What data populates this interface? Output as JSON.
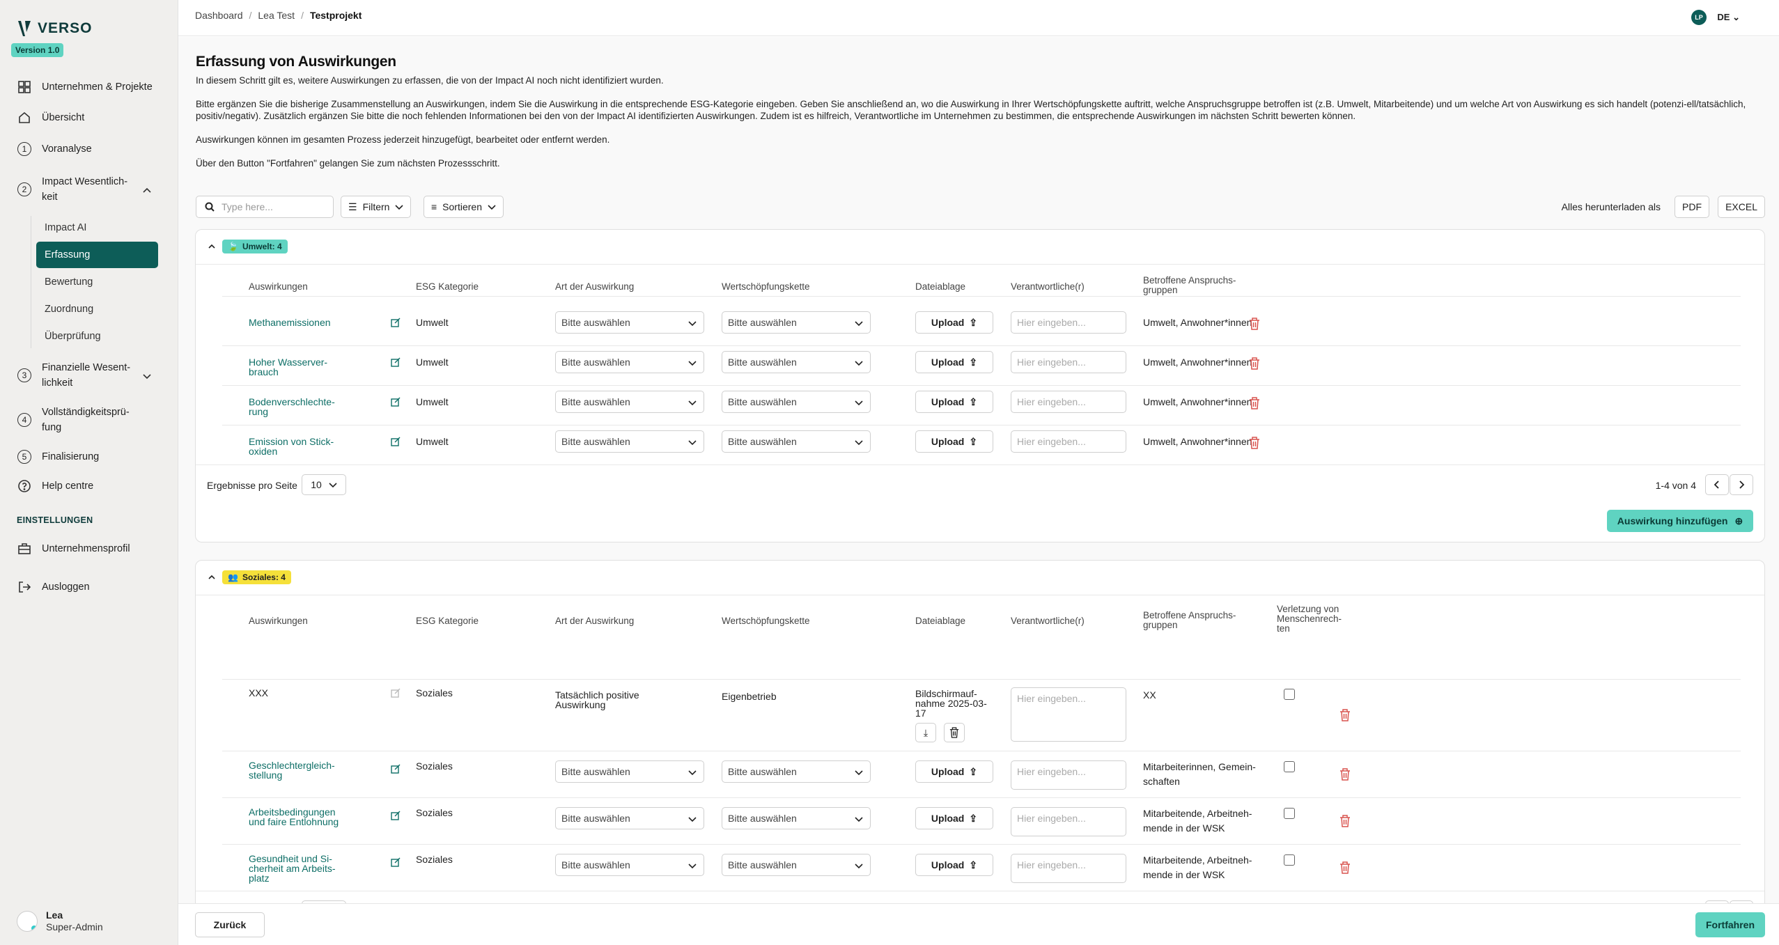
{
  "sidebar": {
    "brand": "VERSO",
    "version": "Version 1.0",
    "items": [
      {
        "label": "Unternehmen & Projekte"
      },
      {
        "label": "Übersicht"
      },
      {
        "label": "Voranalyse",
        "num": "1"
      },
      {
        "label": "Impact Wesentlich-keit",
        "num": "2"
      },
      {
        "label": "Finanzielle Wesent-lichkeit",
        "num": "3"
      },
      {
        "label": "Vollständigkeitsprü-fung",
        "num": "4"
      },
      {
        "label": "Finalisierung",
        "num": "5"
      },
      {
        "label": "Help centre"
      }
    ],
    "subitems": [
      "Impact AI",
      "Erfassung",
      "Bewertung",
      "Zuordnung",
      "Überprüfung"
    ],
    "settings_heading": "EINSTELLUNGEN",
    "profile": "Unternehmensprofil",
    "logout": "Ausloggen",
    "user_name": "Lea",
    "user_role": "Super-Admin"
  },
  "topbar": {
    "crumbs": [
      "Dashboard",
      "Lea Test",
      "Testprojekt"
    ],
    "initials": "LP",
    "lang": "DE"
  },
  "page": {
    "title": "Erfassung von Auswirkungen",
    "intro": [
      "In diesem Schritt gilt es, weitere Auswirkungen zu erfassen, die von der Impact AI noch nicht identifiziert wurden.",
      "Bitte ergänzen Sie die bisherige Zusammenstellung an Auswirkungen, indem Sie die Auswirkung in die entsprechende ESG-Kategorie eingeben. Geben Sie anschließend an, wo die Auswirkung in Ihrer Wertschöpfungskette auftritt, welche Anspruchsgruppe betroffen ist (z.B. Umwelt, Mitarbeitende) und um welche Art von Auswirkung es sich handelt (potenzi-ell/tatsächlich, positiv/negativ). Zusätzlich ergänzen Sie bitte die noch fehlenden Informationen bei den von der Impact AI identifizierten Auswirkungen. Zudem ist es hilfreich, Verantwortliche im Unternehmen zu bestimmen, die entsprechende Auswirkungen im nächsten Schritt bewerten können.",
      "Auswirkungen können im gesamten Prozess jederzeit hinzugefügt, bearbeitet oder entfernt werden.",
      "Über den Button \"Fortfahren\" gelangen Sie zum nächsten Prozessschritt."
    ]
  },
  "toolbar": {
    "search_placeholder": "Type here...",
    "filter": "Filtern",
    "sort": "Sortieren",
    "download_label": "Alles herunterladen als",
    "pdf": "PDF",
    "excel": "EXCEL"
  },
  "columns": {
    "impacts": "Auswirkungen",
    "esg": "ESG Kategorie",
    "type": "Art der Auswirkung",
    "chain": "Wertschöpfungskette",
    "files": "Dateiablage",
    "resp": "Verantwortliche(r)",
    "groups": "Betroffene Anspruchs-gruppen",
    "hr": "Verletzung von Menschenrech-ten"
  },
  "common": {
    "select_placeholder": "Bitte auswählen",
    "upload": "Upload",
    "input_placeholder": "Hier eingeben...",
    "per_page_label": "Ergebnisse pro Seite",
    "per_page": "10",
    "range": "1-4 von 4",
    "add": "Auswirkung hinzufügen"
  },
  "umwelt": {
    "badge": "Umwelt: 4",
    "rows": [
      {
        "name": "Methanemissionen",
        "esg": "Umwelt",
        "groups": "Umwelt, Anwohner*innen"
      },
      {
        "name": "Hoher Wasserver-brauch",
        "esg": "Umwelt",
        "groups": "Umwelt, Anwohner*innen"
      },
      {
        "name": "Bodenverschlechte-rung",
        "esg": "Umwelt",
        "groups": "Umwelt, Anwohner*innen"
      },
      {
        "name": "Emission von Stick-oxiden",
        "esg": "Umwelt",
        "groups": "Umwelt, Anwohner*innen"
      }
    ]
  },
  "soziales": {
    "badge": "Soziales: 4",
    "rows": [
      {
        "name": "XXX",
        "esg": "Soziales",
        "type": "Tatsächlich positive Auswirkung",
        "chain": "Eigenbetrieb",
        "file": "Bildschirmauf-nahme 2025-03-17",
        "groups": "XX"
      },
      {
        "name": "Geschlechtergleich-stellung",
        "esg": "Soziales",
        "groups": "Mitarbeiterinnen, Gemein-schaften"
      },
      {
        "name": "Arbeitsbedingungen und faire Entlohnung",
        "esg": "Soziales",
        "groups": "Mitarbeitende, Arbeitneh-mende in der WSK"
      },
      {
        "name": "Gesundheit und Si-cherheit am Arbeits-platz",
        "esg": "Soziales",
        "groups": "Mitarbeitende, Arbeitneh-mende in der WSK"
      }
    ]
  },
  "footer": {
    "back": "Zurück",
    "next": "Fortfahren"
  },
  "colors": {
    "accent": "#5fd3c1",
    "active": "#0d5d58",
    "link": "#0d6e66",
    "danger": "#d9534f",
    "social_badge": "#f5e03a"
  }
}
